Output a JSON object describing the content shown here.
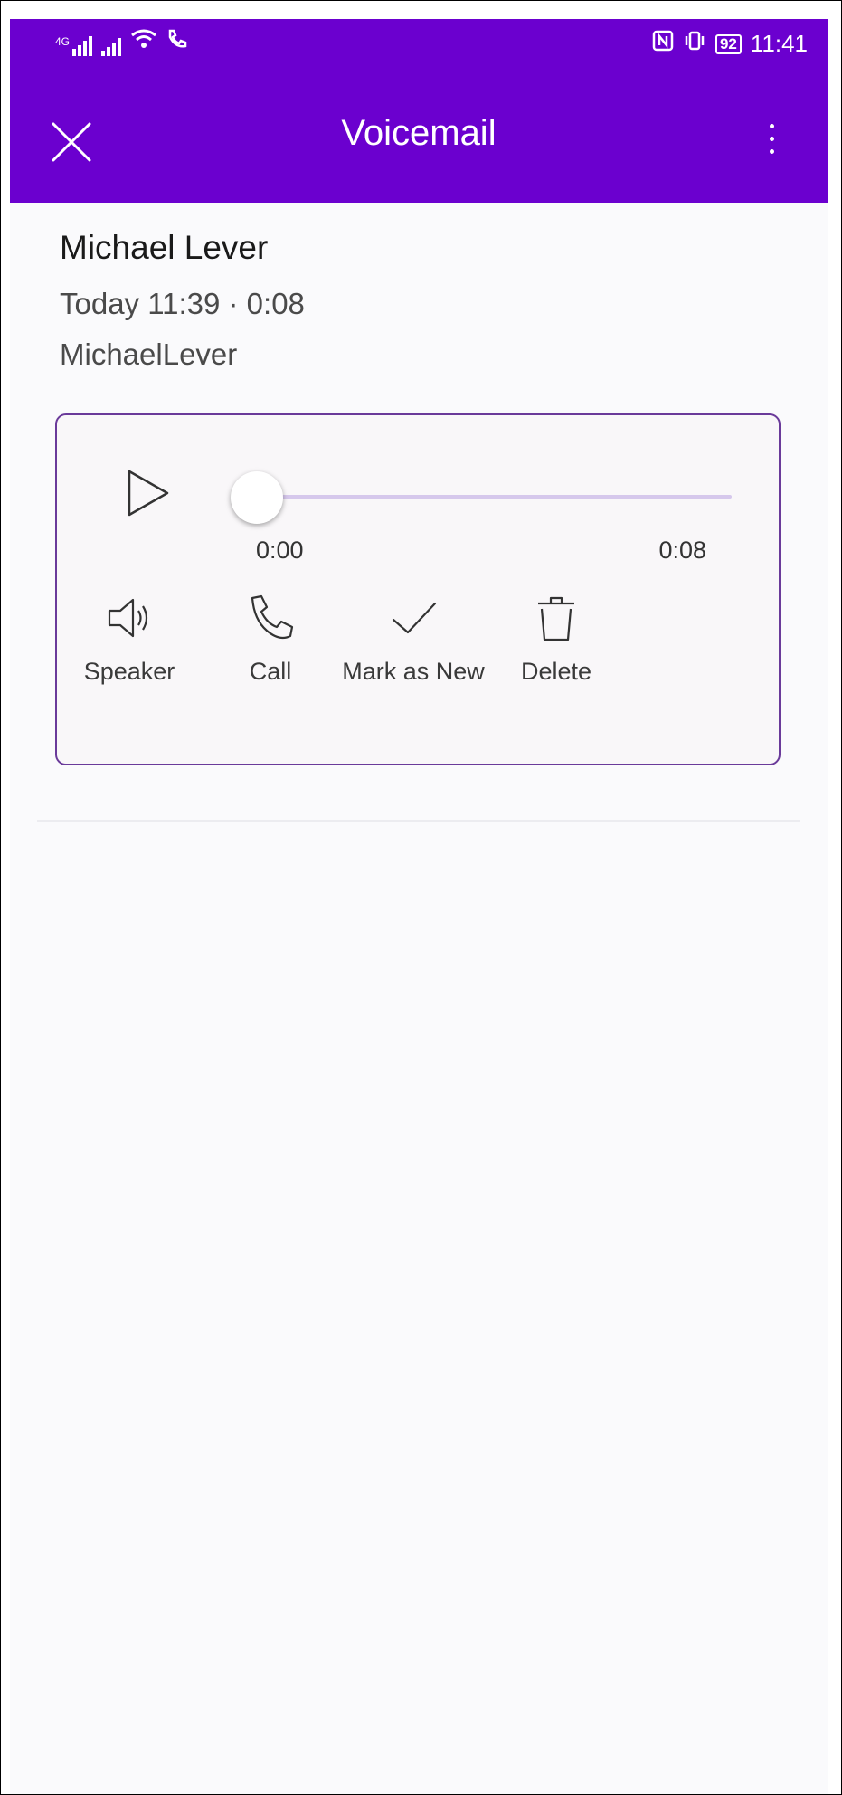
{
  "status_bar": {
    "network_label": "4G",
    "time": "11:41",
    "battery": "92"
  },
  "header": {
    "title": "Voicemail",
    "close_icon": "close-icon",
    "more_icon": "more-vertical-icon"
  },
  "voicemail": {
    "caller_name": "Michael Lever",
    "meta": "Today 11:39 · 0:08",
    "username": "MichaelLever"
  },
  "player": {
    "current_time": "0:00",
    "total_time": "0:08",
    "progress": 0
  },
  "actions": [
    {
      "label": "Speaker",
      "icon": "speaker-icon"
    },
    {
      "label": "Call",
      "icon": "phone-icon"
    },
    {
      "label": "Mark as New",
      "icon": "checkmark-icon"
    },
    {
      "label": "Delete",
      "icon": "trash-icon"
    }
  ],
  "colors": {
    "accent": "#6b00cf",
    "player_border": "#6a3a9a",
    "track": "#d6c8ec"
  }
}
